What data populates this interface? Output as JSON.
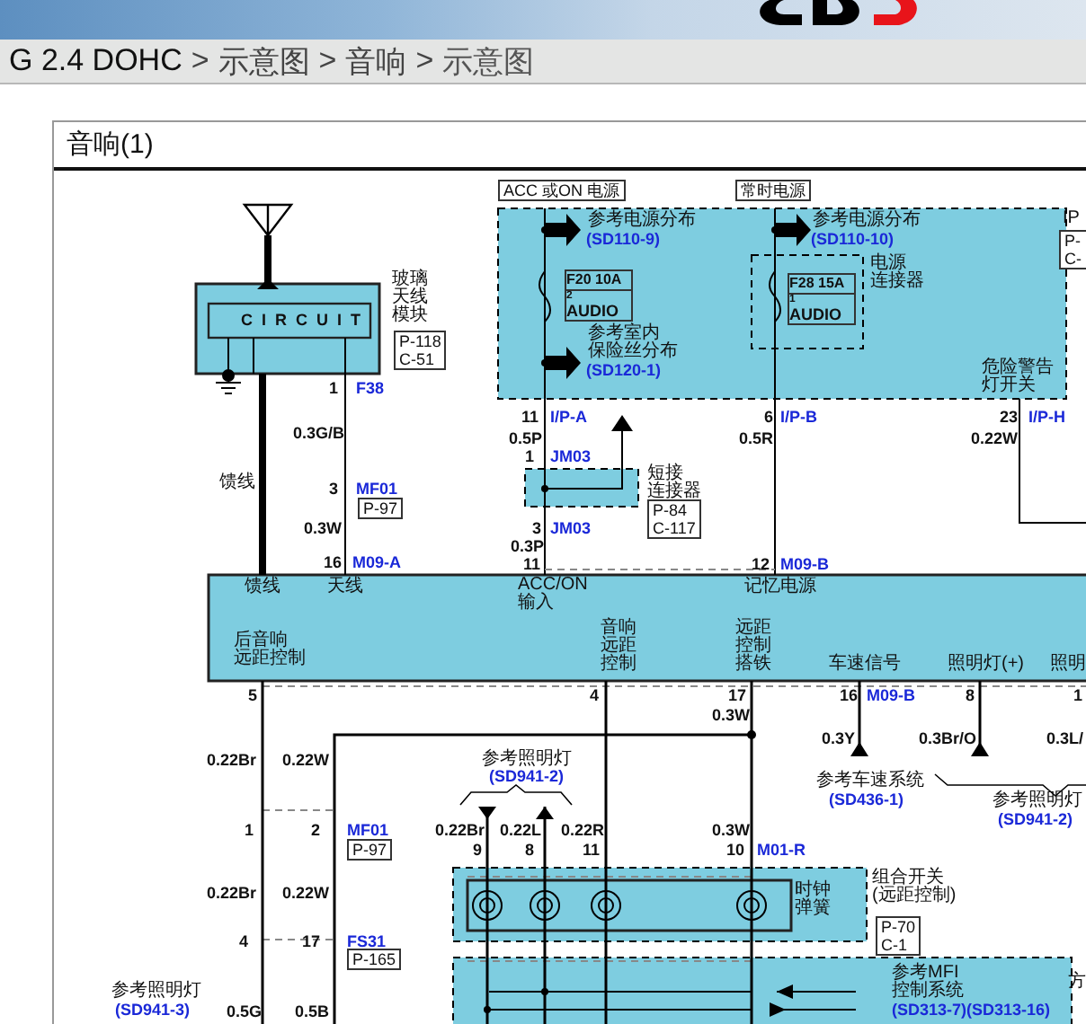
{
  "breadcrumb": [
    {
      "text": "G 2.4 DOHC",
      "current": false
    },
    {
      "text": ">",
      "current": false
    },
    {
      "text": "示意图",
      "current": false
    },
    {
      "text": ">",
      "current": false
    },
    {
      "text": "音响",
      "current": false
    },
    {
      "text": ">",
      "current": false
    },
    {
      "text": "示意图",
      "current": true
    }
  ],
  "panel": {
    "title": "音响(1)"
  },
  "diagram": {
    "labels": [
      {
        "kind": "circuit",
        "lines": [
          "CIRCUIT"
        ]
      },
      {
        "kind": "text",
        "lines": [
          "玻璃",
          "天线",
          "模块"
        ]
      },
      {
        "kind": "tag",
        "lines": [
          "P-118",
          "C-51"
        ]
      },
      {
        "kind": "pin",
        "lines": [
          "1"
        ]
      },
      {
        "kind": "code",
        "lines": [
          "F38"
        ]
      },
      {
        "kind": "wire",
        "lines": [
          "0.3G/B"
        ]
      },
      {
        "kind": "text",
        "lines": [
          "馈线"
        ]
      },
      {
        "kind": "pin",
        "lines": [
          "3"
        ]
      },
      {
        "kind": "code",
        "lines": [
          "MF01"
        ]
      },
      {
        "kind": "tag",
        "lines": [
          "P-97"
        ]
      },
      {
        "kind": "wire",
        "lines": [
          "0.3W"
        ]
      },
      {
        "kind": "pin",
        "lines": [
          "16"
        ]
      },
      {
        "kind": "code",
        "lines": [
          "M09-A"
        ]
      },
      {
        "kind": "tag",
        "lines": [
          "ACC 或ON 电源"
        ]
      },
      {
        "kind": "tag",
        "lines": [
          "常时电源"
        ]
      },
      {
        "kind": "text",
        "lines": [
          "参考电源分布"
        ]
      },
      {
        "kind": "ref",
        "lines": [
          "(SD110-9)"
        ]
      },
      {
        "kind": "fuse",
        "lines": [
          "F20 10A",
          "2",
          "AUDIO"
        ]
      },
      {
        "kind": "text",
        "lines": [
          "参考室内",
          "保险丝分布"
        ]
      },
      {
        "kind": "ref",
        "lines": [
          "(SD120-1)"
        ]
      },
      {
        "kind": "text",
        "lines": [
          "参考电源分布"
        ]
      },
      {
        "kind": "ref",
        "lines": [
          "(SD110-10)"
        ]
      },
      {
        "kind": "fuse",
        "lines": [
          "F28 15A",
          "1",
          "AUDIO"
        ]
      },
      {
        "kind": "text",
        "lines": [
          "电源",
          "连接器"
        ]
      },
      {
        "kind": "text",
        "lines": [
          "IP"
        ]
      },
      {
        "kind": "tag",
        "lines": [
          "P-",
          "C-"
        ]
      },
      {
        "kind": "text",
        "lines": [
          "危险警告",
          "灯开关"
        ]
      },
      {
        "kind": "pin",
        "lines": [
          "11"
        ]
      },
      {
        "kind": "code",
        "lines": [
          "I/P-A"
        ]
      },
      {
        "kind": "wire",
        "lines": [
          "0.5P"
        ]
      },
      {
        "kind": "pin",
        "lines": [
          "1"
        ]
      },
      {
        "kind": "code",
        "lines": [
          "JM03"
        ]
      },
      {
        "kind": "text",
        "lines": [
          "短接",
          "连接器"
        ]
      },
      {
        "kind": "pin",
        "lines": [
          "3"
        ]
      },
      {
        "kind": "code",
        "lines": [
          "JM03"
        ]
      },
      {
        "kind": "tag",
        "lines": [
          "P-84",
          "C-117"
        ]
      },
      {
        "kind": "wire",
        "lines": [
          "0.3P"
        ]
      },
      {
        "kind": "pin",
        "lines": [
          "11"
        ]
      },
      {
        "kind": "pin",
        "lines": [
          "6"
        ]
      },
      {
        "kind": "code",
        "lines": [
          "I/P-B"
        ]
      },
      {
        "kind": "wire",
        "lines": [
          "0.5R"
        ]
      },
      {
        "kind": "pin",
        "lines": [
          "12"
        ]
      },
      {
        "kind": "code",
        "lines": [
          "M09-B"
        ]
      },
      {
        "kind": "pin",
        "lines": [
          "23"
        ]
      },
      {
        "kind": "code",
        "lines": [
          "I/P-H"
        ]
      },
      {
        "kind": "wire",
        "lines": [
          "0.22W"
        ]
      },
      {
        "kind": "text",
        "lines": [
          "馈线"
        ]
      },
      {
        "kind": "text",
        "lines": [
          "天线"
        ]
      },
      {
        "kind": "text",
        "lines": [
          "ACC/ON",
          "输入"
        ]
      },
      {
        "kind": "text",
        "lines": [
          "记忆电源"
        ]
      },
      {
        "kind": "text",
        "lines": [
          "后音响",
          "远距控制"
        ]
      },
      {
        "kind": "text",
        "lines": [
          "音响",
          "远距",
          "控制"
        ]
      },
      {
        "kind": "text",
        "lines": [
          "远距",
          "控制",
          "搭铁"
        ]
      },
      {
        "kind": "text",
        "lines": [
          "车速信号"
        ]
      },
      {
        "kind": "text",
        "lines": [
          "照明灯(+)"
        ]
      },
      {
        "kind": "text",
        "lines": [
          "照明"
        ]
      },
      {
        "kind": "pin",
        "lines": [
          "5"
        ]
      },
      {
        "kind": "pin",
        "lines": [
          "4"
        ]
      },
      {
        "kind": "pin",
        "lines": [
          "17"
        ]
      },
      {
        "kind": "pin",
        "lines": [
          "16"
        ]
      },
      {
        "kind": "code",
        "lines": [
          "M09-B"
        ]
      },
      {
        "kind": "pin",
        "lines": [
          "8"
        ]
      },
      {
        "kind": "pin",
        "lines": [
          "1"
        ]
      },
      {
        "kind": "wire",
        "lines": [
          "0.3W"
        ]
      },
      {
        "kind": "wire",
        "lines": [
          "0.22Br"
        ]
      },
      {
        "kind": "wire",
        "lines": [
          "0.22W"
        ]
      },
      {
        "kind": "wire",
        "lines": [
          "0.3Y"
        ]
      },
      {
        "kind": "wire",
        "lines": [
          "0.3Br/O"
        ]
      },
      {
        "kind": "wire",
        "lines": [
          "0.3L/"
        ]
      },
      {
        "kind": "text",
        "lines": [
          "参考车速系统"
        ]
      },
      {
        "kind": "ref",
        "lines": [
          "(SD436-1)"
        ]
      },
      {
        "kind": "text",
        "lines": [
          "参考照明灯"
        ]
      },
      {
        "kind": "ref",
        "lines": [
          "(SD941-2)"
        ]
      },
      {
        "kind": "text",
        "lines": [
          "参考照明灯"
        ]
      },
      {
        "kind": "ref",
        "lines": [
          "(SD941-2)"
        ]
      },
      {
        "kind": "wire",
        "lines": [
          "0.22Br"
        ]
      },
      {
        "kind": "wire",
        "lines": [
          "0.22L"
        ]
      },
      {
        "kind": "wire",
        "lines": [
          "0.22R"
        ]
      },
      {
        "kind": "pin",
        "lines": [
          "9"
        ]
      },
      {
        "kind": "pin",
        "lines": [
          "8"
        ]
      },
      {
        "kind": "pin",
        "lines": [
          "11"
        ]
      },
      {
        "kind": "wire",
        "lines": [
          "0.3W"
        ]
      },
      {
        "kind": "pin",
        "lines": [
          "10"
        ]
      },
      {
        "kind": "code",
        "lines": [
          "M01-R"
        ]
      },
      {
        "kind": "pin",
        "lines": [
          "1"
        ]
      },
      {
        "kind": "pin",
        "lines": [
          "2"
        ]
      },
      {
        "kind": "code",
        "lines": [
          "MF01"
        ]
      },
      {
        "kind": "tag",
        "lines": [
          "P-97"
        ]
      },
      {
        "kind": "wire",
        "lines": [
          "0.22Br"
        ]
      },
      {
        "kind": "wire",
        "lines": [
          "0.22W"
        ]
      },
      {
        "kind": "text",
        "lines": [
          "组合开关",
          "(远距控制)"
        ]
      },
      {
        "kind": "text",
        "lines": [
          "时钟",
          "弹簧"
        ]
      },
      {
        "kind": "pin",
        "lines": [
          "4"
        ]
      },
      {
        "kind": "pin",
        "lines": [
          "17"
        ]
      },
      {
        "kind": "code",
        "lines": [
          "FS31"
        ]
      },
      {
        "kind": "tag",
        "lines": [
          "P-165"
        ]
      },
      {
        "kind": "tag",
        "lines": [
          "P-70",
          "C-1"
        ]
      },
      {
        "kind": "text",
        "lines": [
          "参考照明灯"
        ]
      },
      {
        "kind": "ref",
        "lines": [
          "(SD941-3)"
        ]
      },
      {
        "kind": "wire",
        "lines": [
          "0.5G"
        ]
      },
      {
        "kind": "wire",
        "lines": [
          "0.5B"
        ]
      },
      {
        "kind": "text",
        "lines": [
          "参考MFI",
          "控制系统"
        ]
      },
      {
        "kind": "ref",
        "lines": [
          "(SD313-7)(SD313-16)"
        ]
      },
      {
        "kind": "text",
        "lines": [
          "方"
        ]
      }
    ]
  }
}
